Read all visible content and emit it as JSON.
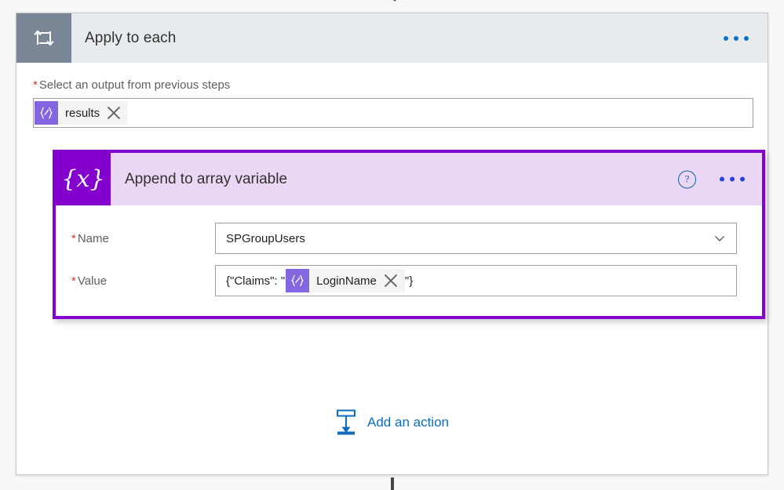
{
  "connectors": {
    "top_arrow_icon": "arrow-down-icon",
    "bottom_line_icon": "connector-line-icon"
  },
  "scope": {
    "icon": "loop-icon",
    "title": "Apply to each",
    "overflow_icon": "ellipsis-icon",
    "foreach_field": {
      "required_marker": "*",
      "label": "Select an output from previous steps",
      "token": {
        "badge_icon": "dynamic-content-icon",
        "text": "results",
        "remove_icon": "close-icon"
      }
    }
  },
  "action": {
    "icon": "{x}",
    "icon_name": "variable-icon",
    "title": "Append to array variable",
    "help_icon": "?",
    "overflow_icon": "ellipsis-icon",
    "parameters": [
      {
        "required_marker": "*",
        "label": "Name",
        "type": "dropdown",
        "value": "SPGroupUsers",
        "chevron_icon": "chevron-down-icon"
      },
      {
        "required_marker": "*",
        "label": "Value",
        "type": "token-input",
        "prefix_text": "{\"Claims\": \"",
        "token": {
          "badge_icon": "dynamic-content-icon",
          "text": "LoginName",
          "remove_icon": "close-icon"
        },
        "suffix_text": "\"}"
      }
    ]
  },
  "add_action": {
    "icon": "add-step-icon",
    "label": "Add an action"
  },
  "colors": {
    "scope_header_bg": "#e8ebed",
    "scope_icon_bg": "#7a8596",
    "action_accent": "#8400cc",
    "action_header_bg": "#e9d7f5",
    "token_badge": "#8367e0",
    "link_blue": "#0f6cbd",
    "required_red": "#d13438"
  }
}
